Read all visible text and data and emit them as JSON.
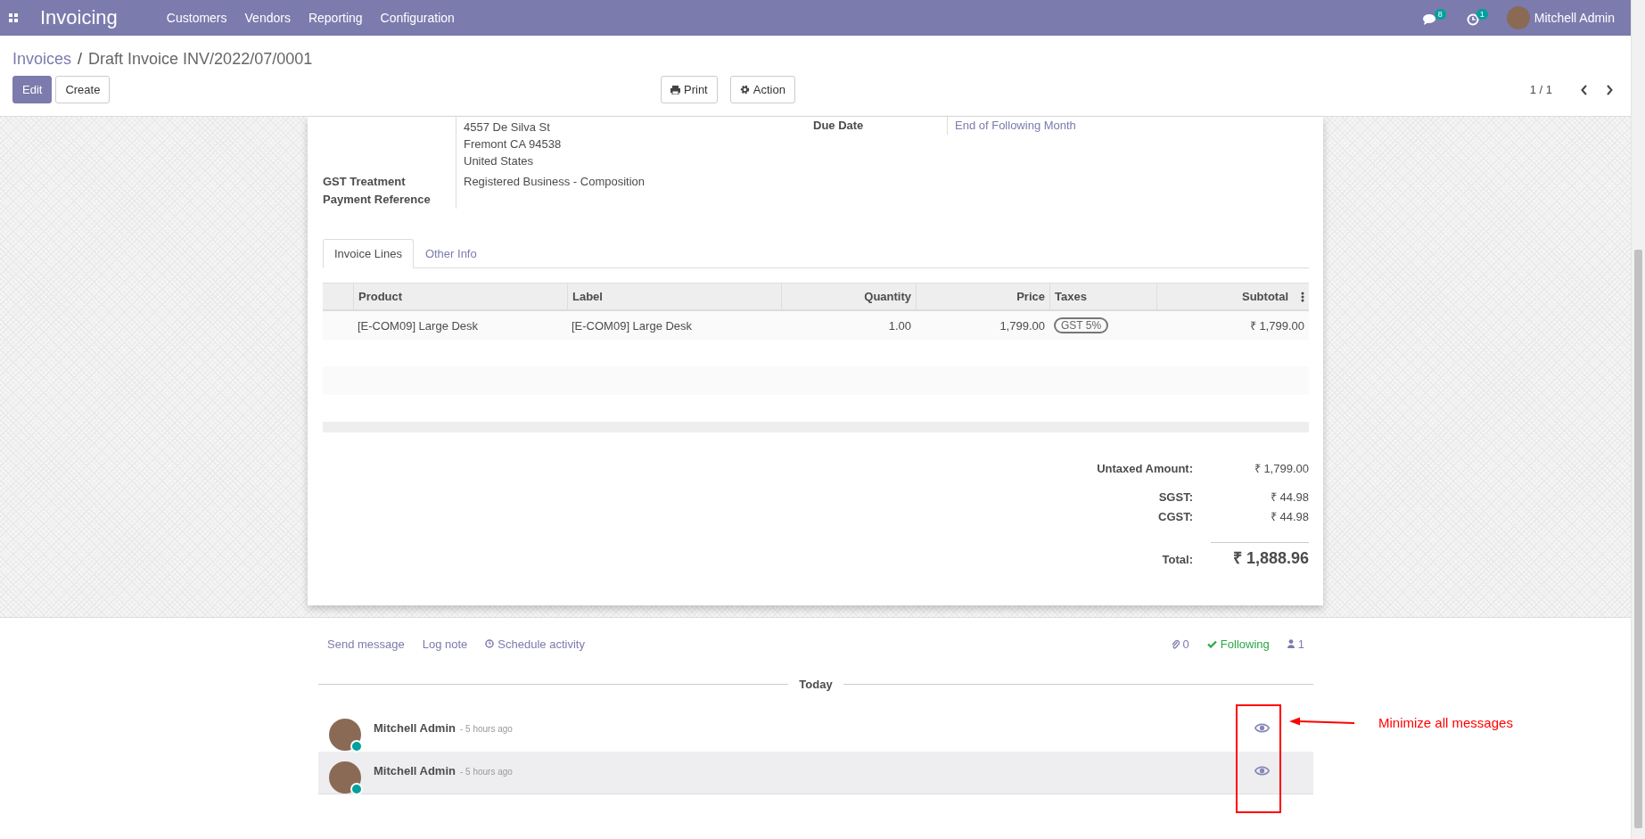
{
  "navbar": {
    "app_name": "Invoicing",
    "menu": [
      "Customers",
      "Vendors",
      "Reporting",
      "Configuration"
    ],
    "messages_count": "8",
    "activities_count": "1",
    "user": "Mitchell Admin"
  },
  "breadcrumb": {
    "parent": "Invoices",
    "separator": "/",
    "current": "Draft Invoice INV/2022/07/0001"
  },
  "buttons": {
    "edit": "Edit",
    "create": "Create",
    "print": "Print",
    "action": "Action"
  },
  "pager": "1 / 1",
  "customer_address": [
    "4557 De Silva St",
    "Fremont CA 94538",
    "United States"
  ],
  "fields_left": [
    {
      "label": "GST Treatment",
      "value": "Registered Business - Composition"
    },
    {
      "label": "Payment Reference"
    }
  ],
  "fields_right": [
    {
      "label": "Due Date",
      "value": "End of Following Month"
    }
  ],
  "tabs": [
    {
      "label": "Invoice Lines",
      "selected": true
    },
    {
      "label": "Other Info",
      "selected": false
    }
  ],
  "table": {
    "columns": [
      "Product",
      "Label",
      "Quantity",
      "Price",
      "Taxes",
      "Subtotal"
    ],
    "rows": [
      {
        "product": "[E-COM09] Large Desk",
        "label": "[E-COM09] Large Desk",
        "quantity": "1.00",
        "price": "1,799.00",
        "taxes": [
          "GST 5%"
        ],
        "subtotal": "₹ 1,799.00"
      }
    ]
  },
  "totals": [
    {
      "kind": "untaxed",
      "label": "Untaxed Amount:",
      "value": "₹ 1,799.00"
    },
    {
      "kind": "tax",
      "label": "SGST:",
      "value": "₹ 44.98"
    },
    {
      "kind": "tax",
      "label": "CGST:",
      "value": "₹ 44.98"
    },
    {
      "kind": "total",
      "label": "Total:",
      "value": "₹ 1,888.96"
    }
  ],
  "chatter": {
    "actions": [
      {
        "kind": "link",
        "label": "Send message"
      },
      {
        "kind": "link",
        "label": "Log note"
      },
      {
        "kind": "activity",
        "label": "Schedule activity"
      }
    ],
    "attachments": "0",
    "following": "Following",
    "followers": "1",
    "date_separator": "Today",
    "messages": [
      {
        "author": "Mitchell Admin",
        "time": "- 5 hours ago",
        "online": true,
        "selected": false
      },
      {
        "author": "Mitchell Admin",
        "time": "- 5 hours ago",
        "online": true,
        "selected": true
      }
    ]
  },
  "annotation": {
    "text": "Minimize all messages"
  }
}
